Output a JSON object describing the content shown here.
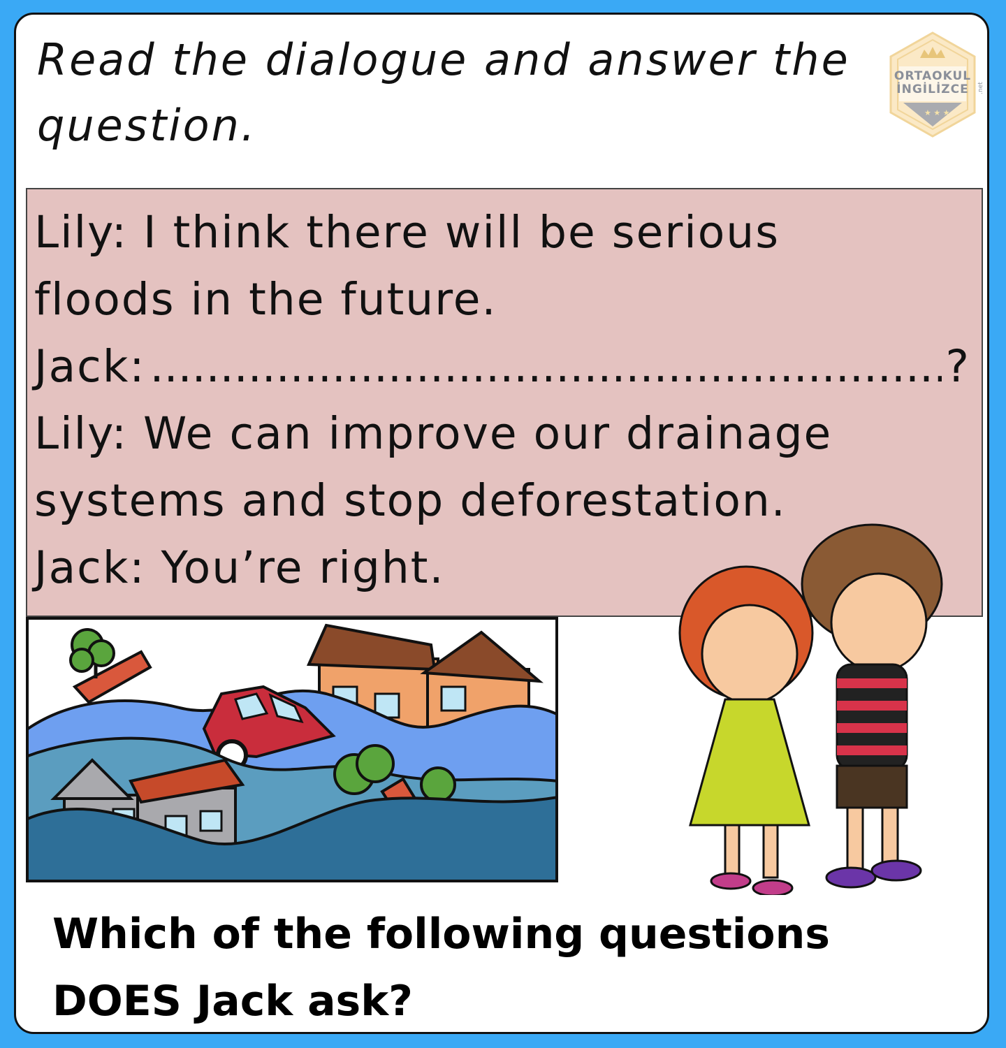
{
  "instruction": "Read the dialogue and answer the question.",
  "logo": {
    "line1": "ORTAOKUL",
    "line2": "İNGİLİZCE",
    "suffix": ".net"
  },
  "dialogue": {
    "lily_line1": "Lily: I think there will be serious",
    "lily_line1_cont": "floods in the future.",
    "jack_speaker": "Jack:",
    "jack_blank": "....................................................................................................................................................................",
    "jack_question_mark": "?",
    "lily_line2": "Lily: We can improve our drainage",
    "lily_line2_cont": "systems and stop deforestation.",
    "jack_line2": "Jack: You’re right."
  },
  "question": "Which of the following questions DOES Jack ask?",
  "colors": {
    "background": "#3aa9f5",
    "dialogue_box": "#e4c2c0",
    "card": "#ffffff"
  },
  "icons": {
    "logo": "hexagon-crown-badge",
    "scene": "flood-illustration",
    "kids": "sad-children-illustration"
  }
}
